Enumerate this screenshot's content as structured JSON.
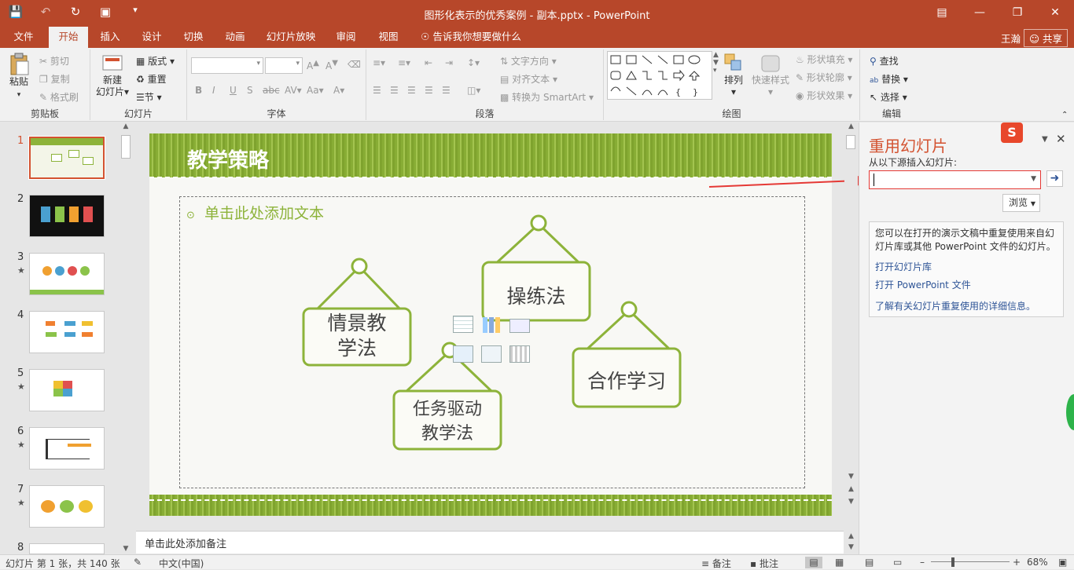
{
  "titlebar": {
    "title": "图形化表示的优秀案例 - 副本.pptx - PowerPoint"
  },
  "tabs": [
    {
      "label": "文件"
    },
    {
      "label": "开始"
    },
    {
      "label": "插入"
    },
    {
      "label": "设计"
    },
    {
      "label": "切换"
    },
    {
      "label": "动画"
    },
    {
      "label": "幻灯片放映"
    },
    {
      "label": "审阅"
    },
    {
      "label": "视图"
    },
    {
      "label": "告诉我你想要做什么"
    }
  ],
  "account": {
    "user": "王瀚",
    "share": "共享"
  },
  "ribbon": {
    "clipboard": {
      "paste": "粘贴",
      "cut": "剪切",
      "copy": "复制",
      "format_painter": "格式刷",
      "label": "剪贴板"
    },
    "slides": {
      "new_slide_l1": "新建",
      "new_slide_l2": "幻灯片",
      "layout": "版式",
      "reset": "重置",
      "section": "节",
      "label": "幻灯片"
    },
    "font": {
      "label": "字体",
      "bold": "B",
      "italic": "I",
      "underline": "U",
      "strike": "S",
      "abc": "abc",
      "av": "AV",
      "aa": "Aa"
    },
    "paragraph": {
      "label": "段落",
      "text_direction": "文字方向",
      "align_text": "对齐文本",
      "smartart": "转换为 SmartArt"
    },
    "drawing": {
      "label": "绘图",
      "arrange": "排列",
      "quick_styles": "快速样式",
      "fill": "形状填充",
      "outline": "形状轮廓",
      "effects": "形状效果"
    },
    "editing": {
      "label": "编辑",
      "find": "查找",
      "replace": "替换",
      "select": "选择"
    }
  },
  "thumbnails": [
    {
      "num": "1",
      "star": ""
    },
    {
      "num": "2",
      "star": ""
    },
    {
      "num": "3",
      "star": "★"
    },
    {
      "num": "4",
      "star": ""
    },
    {
      "num": "5",
      "star": "★"
    },
    {
      "num": "6",
      "star": "★"
    },
    {
      "num": "7",
      "star": "★"
    },
    {
      "num": "8",
      "star": ""
    }
  ],
  "slide": {
    "title": "教学策略",
    "placeholder": "单击此处添加文本",
    "signs": [
      {
        "l1": "情景教",
        "l2": "学法"
      },
      {
        "l1": "操练法",
        "l2": ""
      },
      {
        "l1": "任务驱动",
        "l2": "教学法"
      },
      {
        "l1": "合作学习",
        "l2": ""
      }
    ]
  },
  "notes": {
    "placeholder": "单击此处添加备注"
  },
  "pane": {
    "title": "重用幻灯片",
    "source_label": "从以下源插入幻灯片:",
    "input_value": "",
    "browse": "浏览",
    "info": "您可以在打开的演示文稿中重复使用来自幻灯片库或其他 PowerPoint 文件的幻灯片。",
    "link_library": "打开幻灯片库",
    "link_file": "打开 PowerPoint 文件",
    "link_learn": "了解有关幻灯片重复使用的详细信息。"
  },
  "status": {
    "slide_info": "幻灯片 第 1 张，共 140 张",
    "language": "中文(中国)",
    "notes": "备注",
    "comments": "批注",
    "zoom": "68%"
  },
  "colors": {
    "accent": "#b7472a",
    "slide_green": "#8db33a",
    "link": "#2f5597",
    "pane_title": "#d35230"
  }
}
